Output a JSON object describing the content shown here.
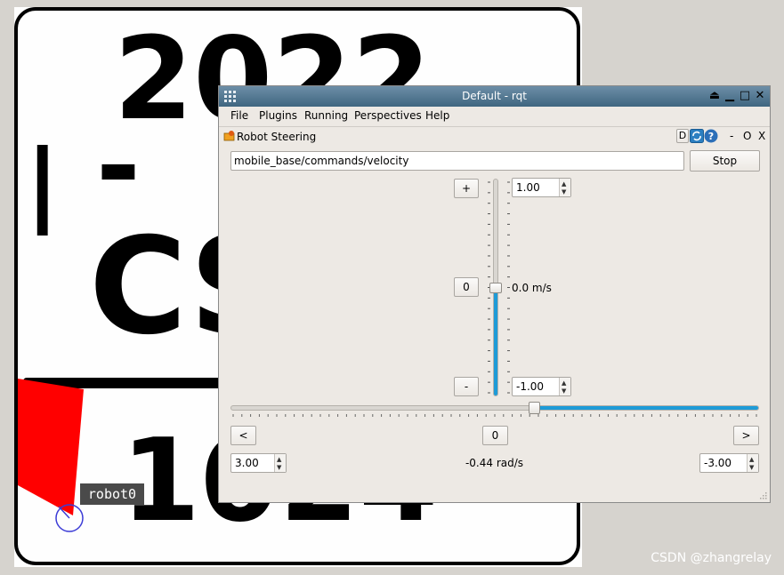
{
  "sim": {
    "big_text_top": "2022",
    "big_text_left": "I",
    "big_text_dash": "-",
    "big_text_mid": "CS",
    "big_text_bottom": "1024",
    "robot_label": "robot0"
  },
  "watermark": "CSDN @zhangrelay",
  "window": {
    "title": "Default - rqt",
    "controls": [
      "⏏",
      "▁",
      "□",
      "✕"
    ]
  },
  "menu": [
    "File",
    "Plugins",
    "Running",
    "Perspectives",
    "Help"
  ],
  "plugin": {
    "title": "Robot Steering",
    "d_button": "D",
    "minus": "-",
    "restore": "O",
    "close": "X"
  },
  "steering": {
    "topic_value": "mobile_base/commands/velocity",
    "stop_label": "Stop",
    "linear": {
      "plus_label": "+",
      "zero_label": "0",
      "minus_label": "-",
      "max_value": "1.00",
      "min_value": "-1.00",
      "readout": "0.0 m/s",
      "value": 0.0,
      "range": [
        -1.0,
        1.0
      ]
    },
    "angular": {
      "left_label": "<",
      "zero_label": "0",
      "right_label": ">",
      "max_value": "3.00",
      "min_value": "-3.00",
      "readout": "-0.44 rad/s",
      "value": -0.44,
      "range": [
        -3.0,
        3.0
      ]
    }
  },
  "colors": {
    "accent": "#1e9bd7",
    "title_bar": "#4f7591",
    "robot_marker": "#ff0000",
    "window_bg": "#ede9e4"
  }
}
